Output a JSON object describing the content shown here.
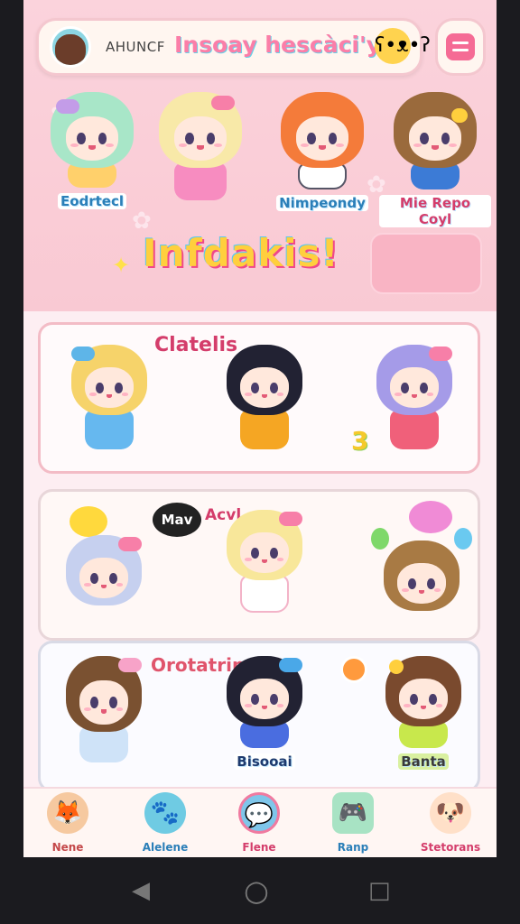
{
  "header": {
    "subtitle": "AHUNCF",
    "title": "Insoay hescàci'y",
    "mascot": "bear-mascot-icon",
    "menu_icon": "menu-icon"
  },
  "featured": [
    {
      "name": "Eodrtecl",
      "hair": "#a8e6c8",
      "outfit": "#ffd06b"
    },
    {
      "name": "",
      "hair": "#f8e9a8",
      "outfit": "#f78cc0"
    },
    {
      "name": "Nimpeondy",
      "hair": "#f47b3a",
      "outfit": "#ffffff"
    },
    {
      "name": "Mie Repo Coyl",
      "hair": "#9a6a3c",
      "outfit": "#3c7bd6"
    }
  ],
  "banner": {
    "text": "Infdakis!"
  },
  "cards": [
    {
      "title": "Clatelis",
      "number": "3",
      "chars": [
        {
          "hair": "#f6d36a",
          "outfit": "#66b8ef"
        },
        {
          "hair": "#222233",
          "outfit": "#f5a623"
        },
        {
          "hair": "#a59be8",
          "outfit": "#f0607a"
        }
      ]
    },
    {
      "title": "Acvl",
      "speech": "Mav",
      "chars": [
        {
          "hair": "#c6d0ef",
          "outfit": "#ffffff"
        },
        {
          "hair": "#f8e79a",
          "outfit": "#ffffff"
        },
        {
          "hair": "#a87a44",
          "outfit": "#f3a6c5"
        }
      ]
    },
    {
      "title": "Orotatrin",
      "chars": [
        {
          "hair": "#7a5131",
          "outfit": "#cfe3f8",
          "label": ""
        },
        {
          "hair": "#222233",
          "outfit": "#4a6de0",
          "label": "Bisooai"
        },
        {
          "hair": "#7a4a2e",
          "outfit": "#c8e84c",
          "label": "Banta"
        }
      ]
    }
  ],
  "nav": [
    {
      "label": "Nene",
      "icon": "fox-character-icon",
      "color": "#c4484a"
    },
    {
      "label": "Alelene",
      "icon": "pet-icon",
      "color": "#2b7fb8"
    },
    {
      "label": "Flene",
      "icon": "chat-bubble-icon",
      "color": "#d43d6b"
    },
    {
      "label": "Ranp",
      "icon": "game-console-icon",
      "color": "#2b7fb8"
    },
    {
      "label": "Stetorans",
      "icon": "mascot-icon",
      "color": "#d43d6b"
    }
  ]
}
